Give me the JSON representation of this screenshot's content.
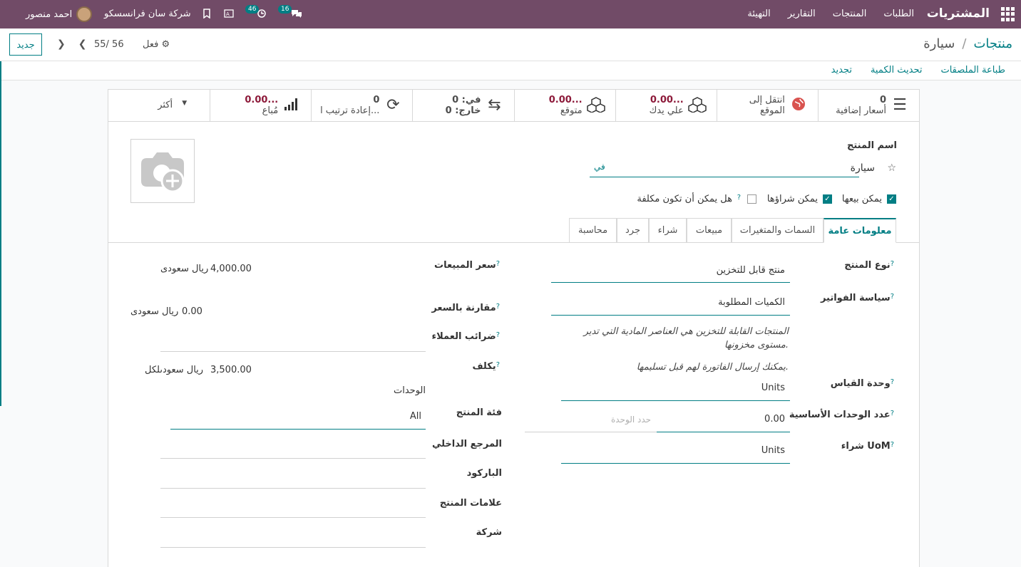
{
  "topbar": {
    "app_name": "المشتريات",
    "menu": [
      "الطلبات",
      "المنتجات",
      "التقارير",
      "التهيئة"
    ],
    "user": "احمد منصور",
    "company": "شركة سان فرانسسكو",
    "activity_count": "46",
    "messages_count": "16"
  },
  "control": {
    "new_label": "جديد",
    "pager": "55/ 56",
    "action_label": "فعل",
    "breadcrumb_parent": "منتجات",
    "breadcrumb_sep": "/",
    "breadcrumb_current": "سيارة"
  },
  "status_links": [
    "طباعة الملصقات",
    "تحديث الكمية",
    "تجديد"
  ],
  "smart_buttons": [
    {
      "value": "0",
      "label": "أسعار إضافية",
      "icon": "list-icon"
    },
    {
      "value": "انتقل إلى",
      "label": "الموقع",
      "icon": "globe-icon"
    },
    {
      "value": "0.00...",
      "label": "علي يدك",
      "icon": "cubes-icon"
    },
    {
      "value": "0.00...",
      "label": "متوقع",
      "icon": "cubes-icon"
    },
    {
      "value": "في: 0",
      "label": "خارج: 0",
      "icon": "transfer-icon"
    },
    {
      "value": "0",
      "label": "إعادة ترتيب ا...",
      "icon": "refresh-icon"
    },
    {
      "value": "0.00...",
      "label": "مُباع",
      "icon": "chart-icon"
    },
    {
      "value": "أكثر",
      "label": "",
      "icon": "caret-down-icon"
    }
  ],
  "product": {
    "name_label": "اسم المنتج",
    "name": "سيارة",
    "lang": "في",
    "can_sell": "يمكن بيعها",
    "can_purchase": "يمكن شراؤها",
    "can_expense": "هل يمكن أن تكون مكلفة"
  },
  "tabs": [
    "معلومات عامة",
    "السمات والمتغيرات",
    "مبيعات",
    "شراء",
    "جرد",
    "محاسبة"
  ],
  "right": {
    "type_label": "نوع المنتج",
    "type_value": "منتج قابل للتخزين",
    "invoice_label": "سياسة الفواتير",
    "invoice_value": "الكميات المطلوبة",
    "note1": "المنتجات القابلة للتخزين هي العناصر المادية التي تدير مستوى مخزونها.",
    "note2": "يمكنك إرسال الفاتورة لهم قبل تسليمها.",
    "uom_label": "وحدة القياس",
    "uom_value": "Units",
    "base_units_label": "عدد الوحدات الأساسية",
    "base_units_value": "0.00",
    "unit_placeholder": "حدد الوحدة",
    "purchase_uom_label": "شراء UoM",
    "purchase_uom_value": "Units"
  },
  "left": {
    "sales_price_label": "سعر المبيعات",
    "sales_price_value": "4,000.00",
    "currency": "ريال سعودى",
    "compare_label": "مقارنة بالسعر",
    "compare_value": "0.00",
    "taxes_label": "ضرائب العملاء",
    "cost_label": "يكلف",
    "cost_value": "3,500.00",
    "cost_unit": "ريال سعودىلكل",
    "units_label": "الوحدات",
    "category_label": "فئة المنتج",
    "category_value": "All",
    "internal_ref_label": "المرجع الداخلي",
    "barcode_label": "الباركود",
    "tags_label": "علامات المنتج",
    "company_label": "شركة"
  }
}
